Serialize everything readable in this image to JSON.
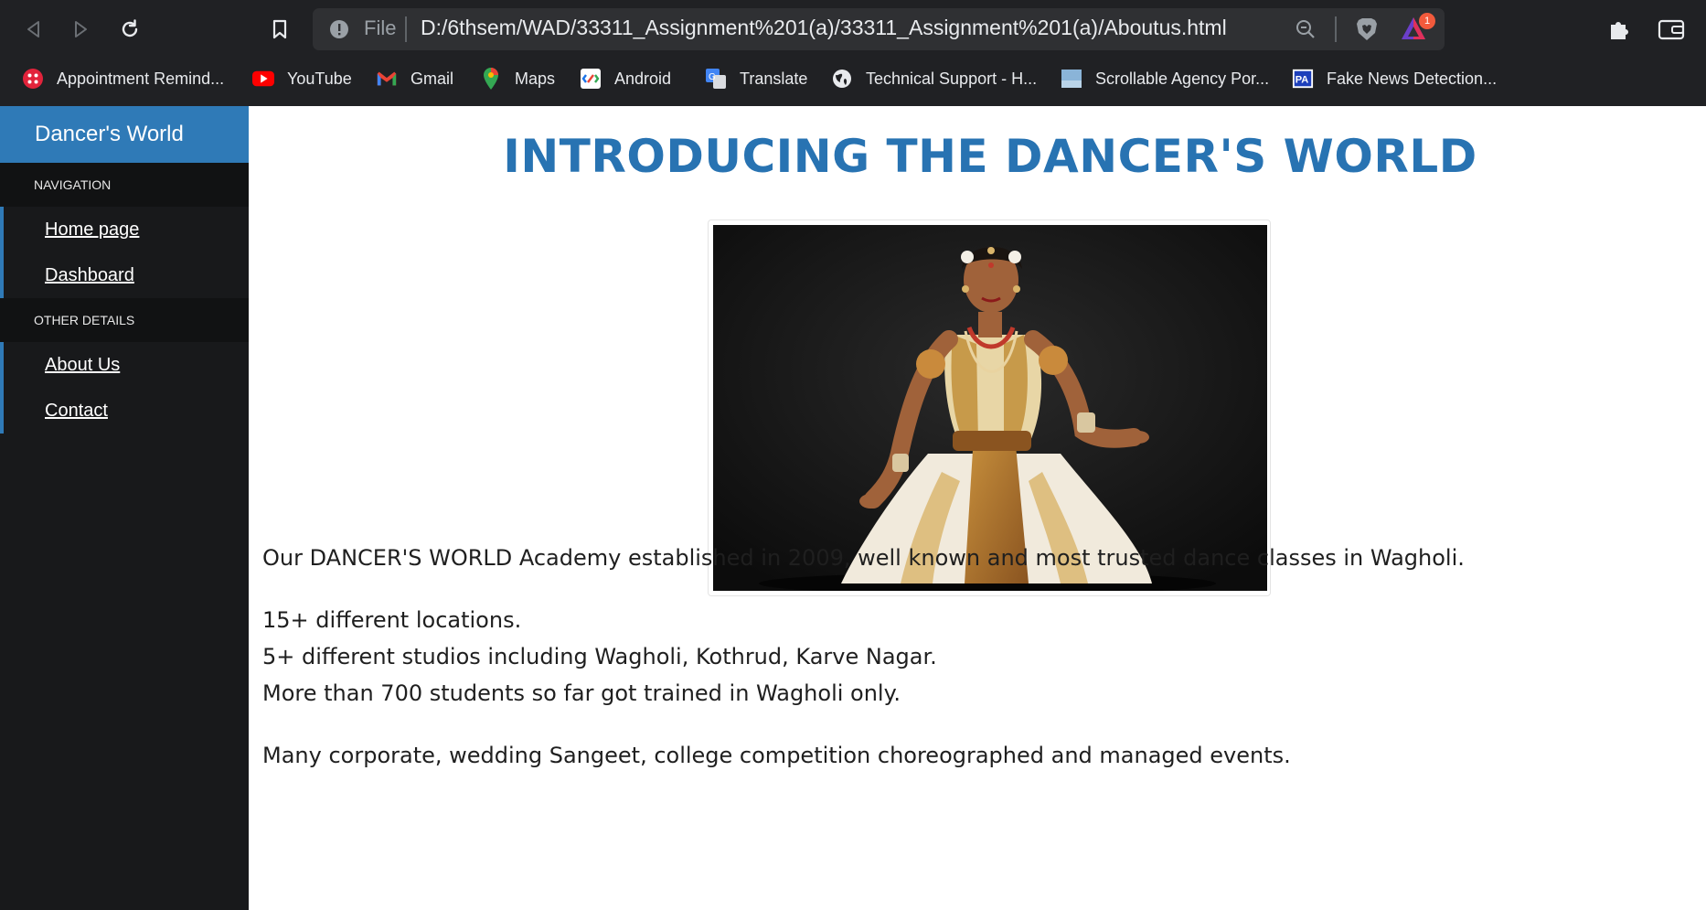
{
  "browser": {
    "url_scheme_label": "File",
    "url": "D:/6thsem/WAD/33311_Assignment%201(a)/33311_Assignment%201(a)/Aboutus.html",
    "rewards_badge": "1",
    "bookmarks": [
      {
        "label": "Appointment Remind...",
        "icon": "appointment-icon"
      },
      {
        "label": "YouTube",
        "icon": "youtube-icon"
      },
      {
        "label": "Gmail",
        "icon": "gmail-icon"
      },
      {
        "label": "Maps",
        "icon": "maps-icon"
      },
      {
        "label": "Android",
        "icon": "android-icon"
      },
      {
        "label": "Translate",
        "icon": "translate-icon"
      },
      {
        "label": "Technical Support - H...",
        "icon": "globe-icon"
      },
      {
        "label": "Scrollable Agency Por...",
        "icon": "image-icon"
      },
      {
        "label": "Fake News Detection...",
        "icon": "fake-news-icon"
      }
    ]
  },
  "sidebar": {
    "brand": "Dancer's World",
    "sections": [
      {
        "heading": "NAVIGATION",
        "items": [
          "Home page",
          "Dashboard"
        ]
      },
      {
        "heading": "OTHER DETAILS",
        "items": [
          "About Us",
          "Contact"
        ]
      }
    ]
  },
  "main": {
    "title": "INTRODUCING THE DANCER'S WORLD",
    "paragraph1": "Our DANCER'S WORLD Academy established in 2009, well known and most trusted dance classes in Wagholi.",
    "facts": [
      "15+ different locations.",
      "5+ different studios including Wagholi, Kothrud, Karve Nagar.",
      "More than 700 students so far got trained in Wagholi only."
    ],
    "paragraph3": "Many corporate, wedding Sangeet, college competition choreographed and managed events."
  },
  "colors": {
    "accent": "#2f7ab7",
    "title": "#2873b2",
    "sidebar_bg": "#18191b",
    "chrome_bg": "#202124"
  }
}
